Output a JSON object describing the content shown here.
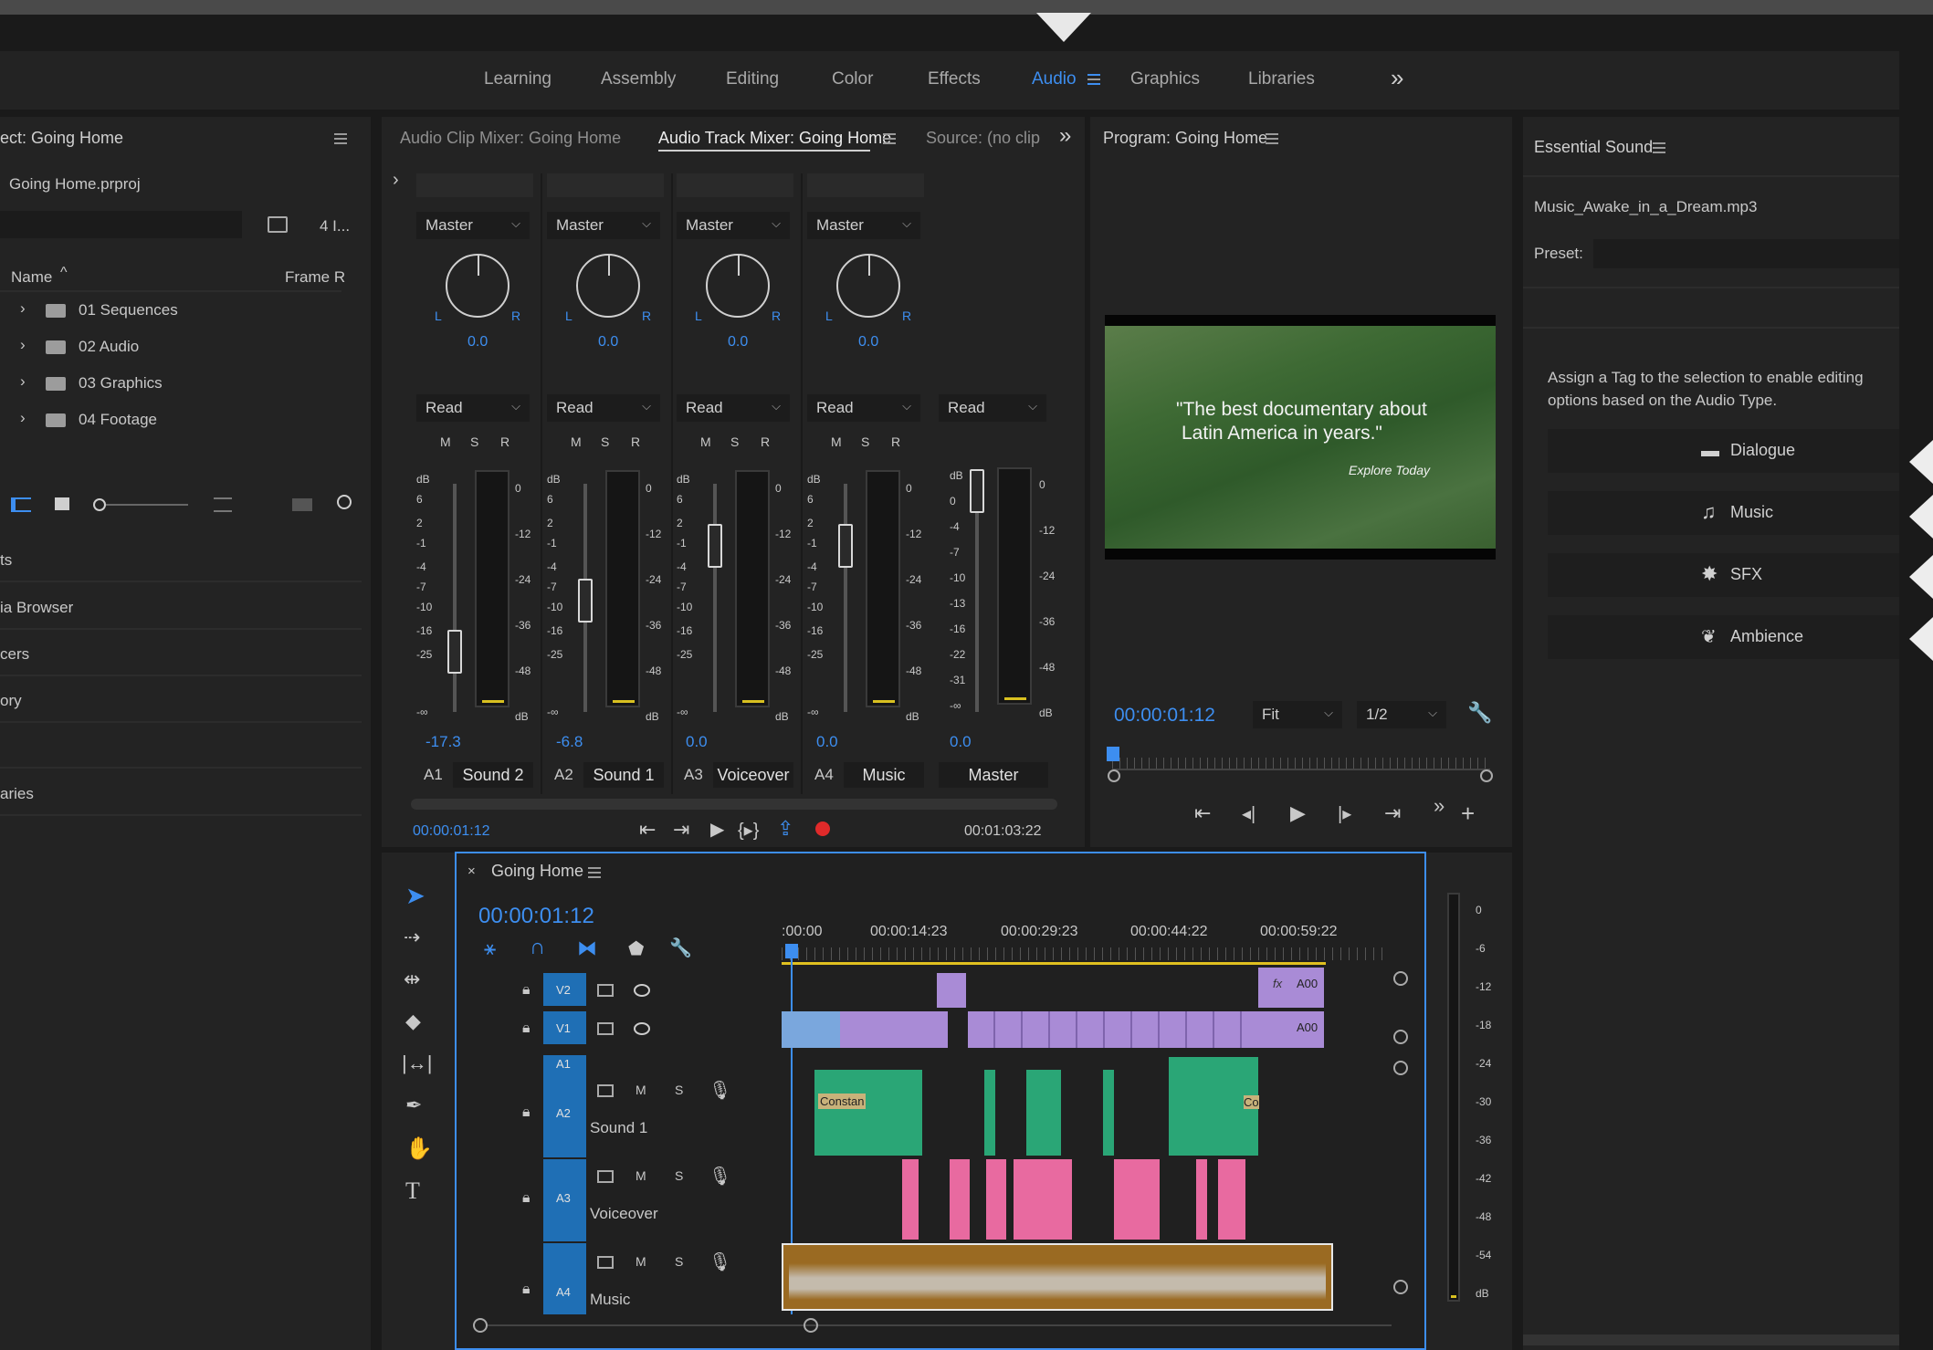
{
  "workspaces": [
    {
      "label": "Learning",
      "active": false
    },
    {
      "label": "Assembly",
      "active": false
    },
    {
      "label": "Editing",
      "active": false
    },
    {
      "label": "Color",
      "active": false
    },
    {
      "label": "Effects",
      "active": false
    },
    {
      "label": "Audio",
      "active": true
    },
    {
      "label": "Graphics",
      "active": false
    },
    {
      "label": "Libraries",
      "active": false
    }
  ],
  "project": {
    "title": "ect: Going Home",
    "file": "Going Home.prproj",
    "item_count": "4 I...",
    "col_name": "Name",
    "col_frame": "Frame R",
    "items": [
      "01 Sequences",
      "02 Audio",
      "03 Graphics",
      "04 Footage"
    ],
    "sections": [
      "ts",
      "ia Browser",
      "cers",
      "ory",
      "aries"
    ]
  },
  "mixer": {
    "tabs": [
      "Audio Clip Mixer: Going Home",
      "Audio Track Mixer: Going Home",
      "Source: (no clip"
    ],
    "channels": [
      {
        "route": "Master",
        "pan": "0.0",
        "mode": "Read",
        "level": "-17.3",
        "id": "A1",
        "name": "Sound 2"
      },
      {
        "route": "Master",
        "pan": "0.0",
        "mode": "Read",
        "level": "-6.8",
        "id": "A2",
        "name": "Sound 1"
      },
      {
        "route": "Master",
        "pan": "0.0",
        "mode": "Read",
        "level": "0.0",
        "id": "A3",
        "name": "Voiceover"
      },
      {
        "route": "Master",
        "pan": "0.0",
        "mode": "Read",
        "level": "0.0",
        "id": "A4",
        "name": "Music"
      }
    ],
    "master": {
      "mode": "Read",
      "level": "0.0",
      "name": "Master"
    },
    "fader_scale": [
      "dB",
      "6",
      "2",
      "-1",
      "-4",
      "-7",
      "-10",
      "-16",
      "-25",
      "-∞"
    ],
    "meter_scale": [
      "0",
      "-12",
      "-24",
      "-36",
      "-48",
      "dB"
    ],
    "master_fader_scale": [
      "dB",
      "0",
      "-4",
      "-7",
      "-10",
      "-13",
      "-16",
      "-22",
      "-31",
      "-∞"
    ],
    "msr": [
      "M",
      "S",
      "R"
    ],
    "pan_l": "L",
    "pan_r": "R",
    "tc_in": "00:00:01:12",
    "tc_out": "00:01:03:22"
  },
  "program": {
    "title": "Program: Going Home",
    "overlay_line1": "\"The best documentary about",
    "overlay_line2": "Latin America in years.\"",
    "overlay_sub": "Explore Today",
    "timecode": "00:00:01:12",
    "fit": "Fit",
    "resolution": "1/2"
  },
  "essential": {
    "title": "Essential Sound",
    "file": "Music_Awake_in_a_Dream.mp3",
    "preset_label": "Preset:",
    "hint_line1": "Assign a Tag to the selection to enable editing",
    "hint_line2": "options based on the Audio Type.",
    "tags": [
      "Dialogue",
      "Music",
      "SFX",
      "Ambience"
    ]
  },
  "timeline": {
    "title": "Going Home",
    "timecode": "00:00:01:12",
    "ruler": [
      ":00:00",
      "00:00:14:23",
      "00:00:29:23",
      "00:00:44:22",
      "00:00:59:22"
    ],
    "video_tracks": [
      "V2",
      "V1"
    ],
    "audio_tracks": [
      {
        "id": "A1",
        "name": ""
      },
      {
        "id": "A2",
        "name": "Sound 1"
      },
      {
        "id": "A3",
        "name": "Voiceover"
      },
      {
        "id": "A4",
        "name": "Music"
      }
    ],
    "clip_label_a00": "A00",
    "clip_label_fx": "fx",
    "clip_label_constant": "Constan",
    "clip_label_co": "Co"
  },
  "meter_right": [
    "0",
    "-6",
    "-12",
    "-18",
    "-24",
    "-30",
    "-36",
    "-42",
    "-48",
    "-54",
    "dB"
  ],
  "colors": {
    "accent": "#3d8ef0",
    "panel": "#232323",
    "video_clip": "#a98bd6",
    "audio_green": "#2aa676",
    "audio_pink": "#e86aa0",
    "music_clip": "#9a6a22"
  }
}
